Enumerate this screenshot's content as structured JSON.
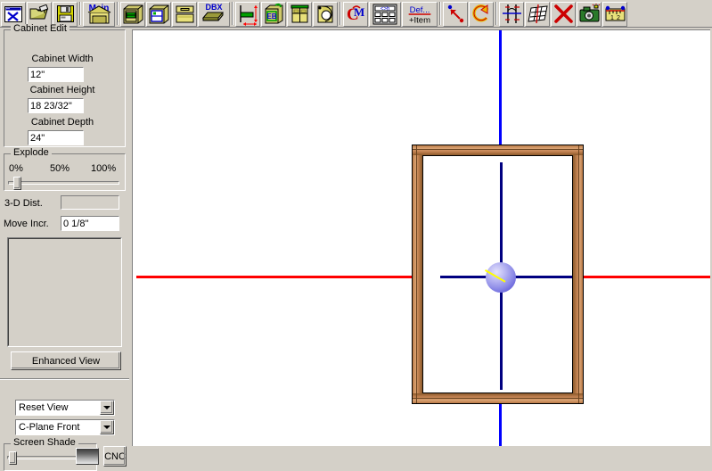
{
  "toolbar": {
    "buttons": [
      {
        "name": "new-document-button",
        "icon": "new-document-icon",
        "label": ""
      },
      {
        "name": "open-folder-button",
        "icon": "open-folder-icon",
        "label": ""
      },
      {
        "name": "save-button",
        "icon": "floppy-disk-save-icon",
        "label": ""
      },
      {
        "name": "main-button",
        "icon": "main-cabinet-icon",
        "label": "Main"
      },
      {
        "name": "base-cabinet-button",
        "icon": "base-cabinet-icon",
        "label": ""
      },
      {
        "name": "wall-cabinet-button",
        "icon": "wall-cabinet-icon",
        "label": ""
      },
      {
        "name": "drawer-cabinet-button",
        "icon": "drawer-cabinet-icon",
        "label": ""
      },
      {
        "name": "dbx-button",
        "icon": "dbx-box-icon",
        "label": "DBX"
      },
      {
        "name": "dimension-button",
        "icon": "dimension-arrows-icon",
        "label": ""
      },
      {
        "name": "edge-band-button",
        "icon": "edge-band-eb-icon",
        "label": "EB"
      },
      {
        "name": "door-panel-button",
        "icon": "door-panel-icon",
        "label": ""
      },
      {
        "name": "hardware-button",
        "icon": "hardware-hinge-icon",
        "label": ""
      },
      {
        "name": "cm-macro-button",
        "icon": "cm-letters-icon",
        "label": "CM"
      },
      {
        "name": "calculator-button",
        "icon": "calculator-icon",
        "label": ""
      },
      {
        "name": "def-item-button",
        "icon": "def-item-text-icon",
        "label1": "Def...",
        "label2": "+Item"
      },
      {
        "name": "point-to-point-button",
        "icon": "point-to-point-arrow-icon",
        "label": ""
      },
      {
        "name": "rotate-button",
        "icon": "rotate-arrow-icon",
        "label": ""
      },
      {
        "name": "mirror-button",
        "icon": "mirror-lines-icon",
        "label": ""
      },
      {
        "name": "grid-button",
        "icon": "grid-icon",
        "label": ""
      },
      {
        "name": "delete-button",
        "icon": "red-x-delete-icon",
        "label": ""
      },
      {
        "name": "camera-snapshot-button",
        "icon": "camera-icon",
        "label": ""
      },
      {
        "name": "measure-button",
        "icon": "ruler-measure-icon",
        "label": ""
      }
    ]
  },
  "sidebar": {
    "cabinet_edit": {
      "group_label": "Cabinet Edit",
      "width_label": "Cabinet Width",
      "width_value": "12\"",
      "height_label": "Cabinet Height",
      "height_value": "18 23/32\"",
      "depth_label": "Cabinet Depth",
      "depth_value": "24\""
    },
    "explode": {
      "group_label": "Explode",
      "tick_min": "0%",
      "tick_mid": "50%",
      "tick_max": "100%",
      "value_percent": 3
    },
    "dist_label": "3-D Dist.",
    "dist_value": "",
    "move_incr_label": "Move Incr.",
    "move_incr_value": "0 1/8\"",
    "enhanced_view_label": "Enhanced View",
    "reset_view_value": "Reset View",
    "cplane_value": "C-Plane Front",
    "screen_shade": {
      "group_label": "Screen Shade",
      "value_percent": 2
    },
    "cnc_label": "CNC"
  },
  "canvas": {
    "background_color": "#ffffff",
    "axis_vertical_color": "#0000ff",
    "axis_horizontal_color": "#ff0000",
    "axis_dark_color": "#000080",
    "cabinet": {
      "frame_outer_color": "#000000",
      "frame_wood_color": "#c08050",
      "frame_wood_dark": "#8b5a2b",
      "frame_wood_light": "#d9a273"
    },
    "gizmo": {
      "sphere_color": "#8f8de8",
      "pointer_color": "#ffff00"
    }
  }
}
